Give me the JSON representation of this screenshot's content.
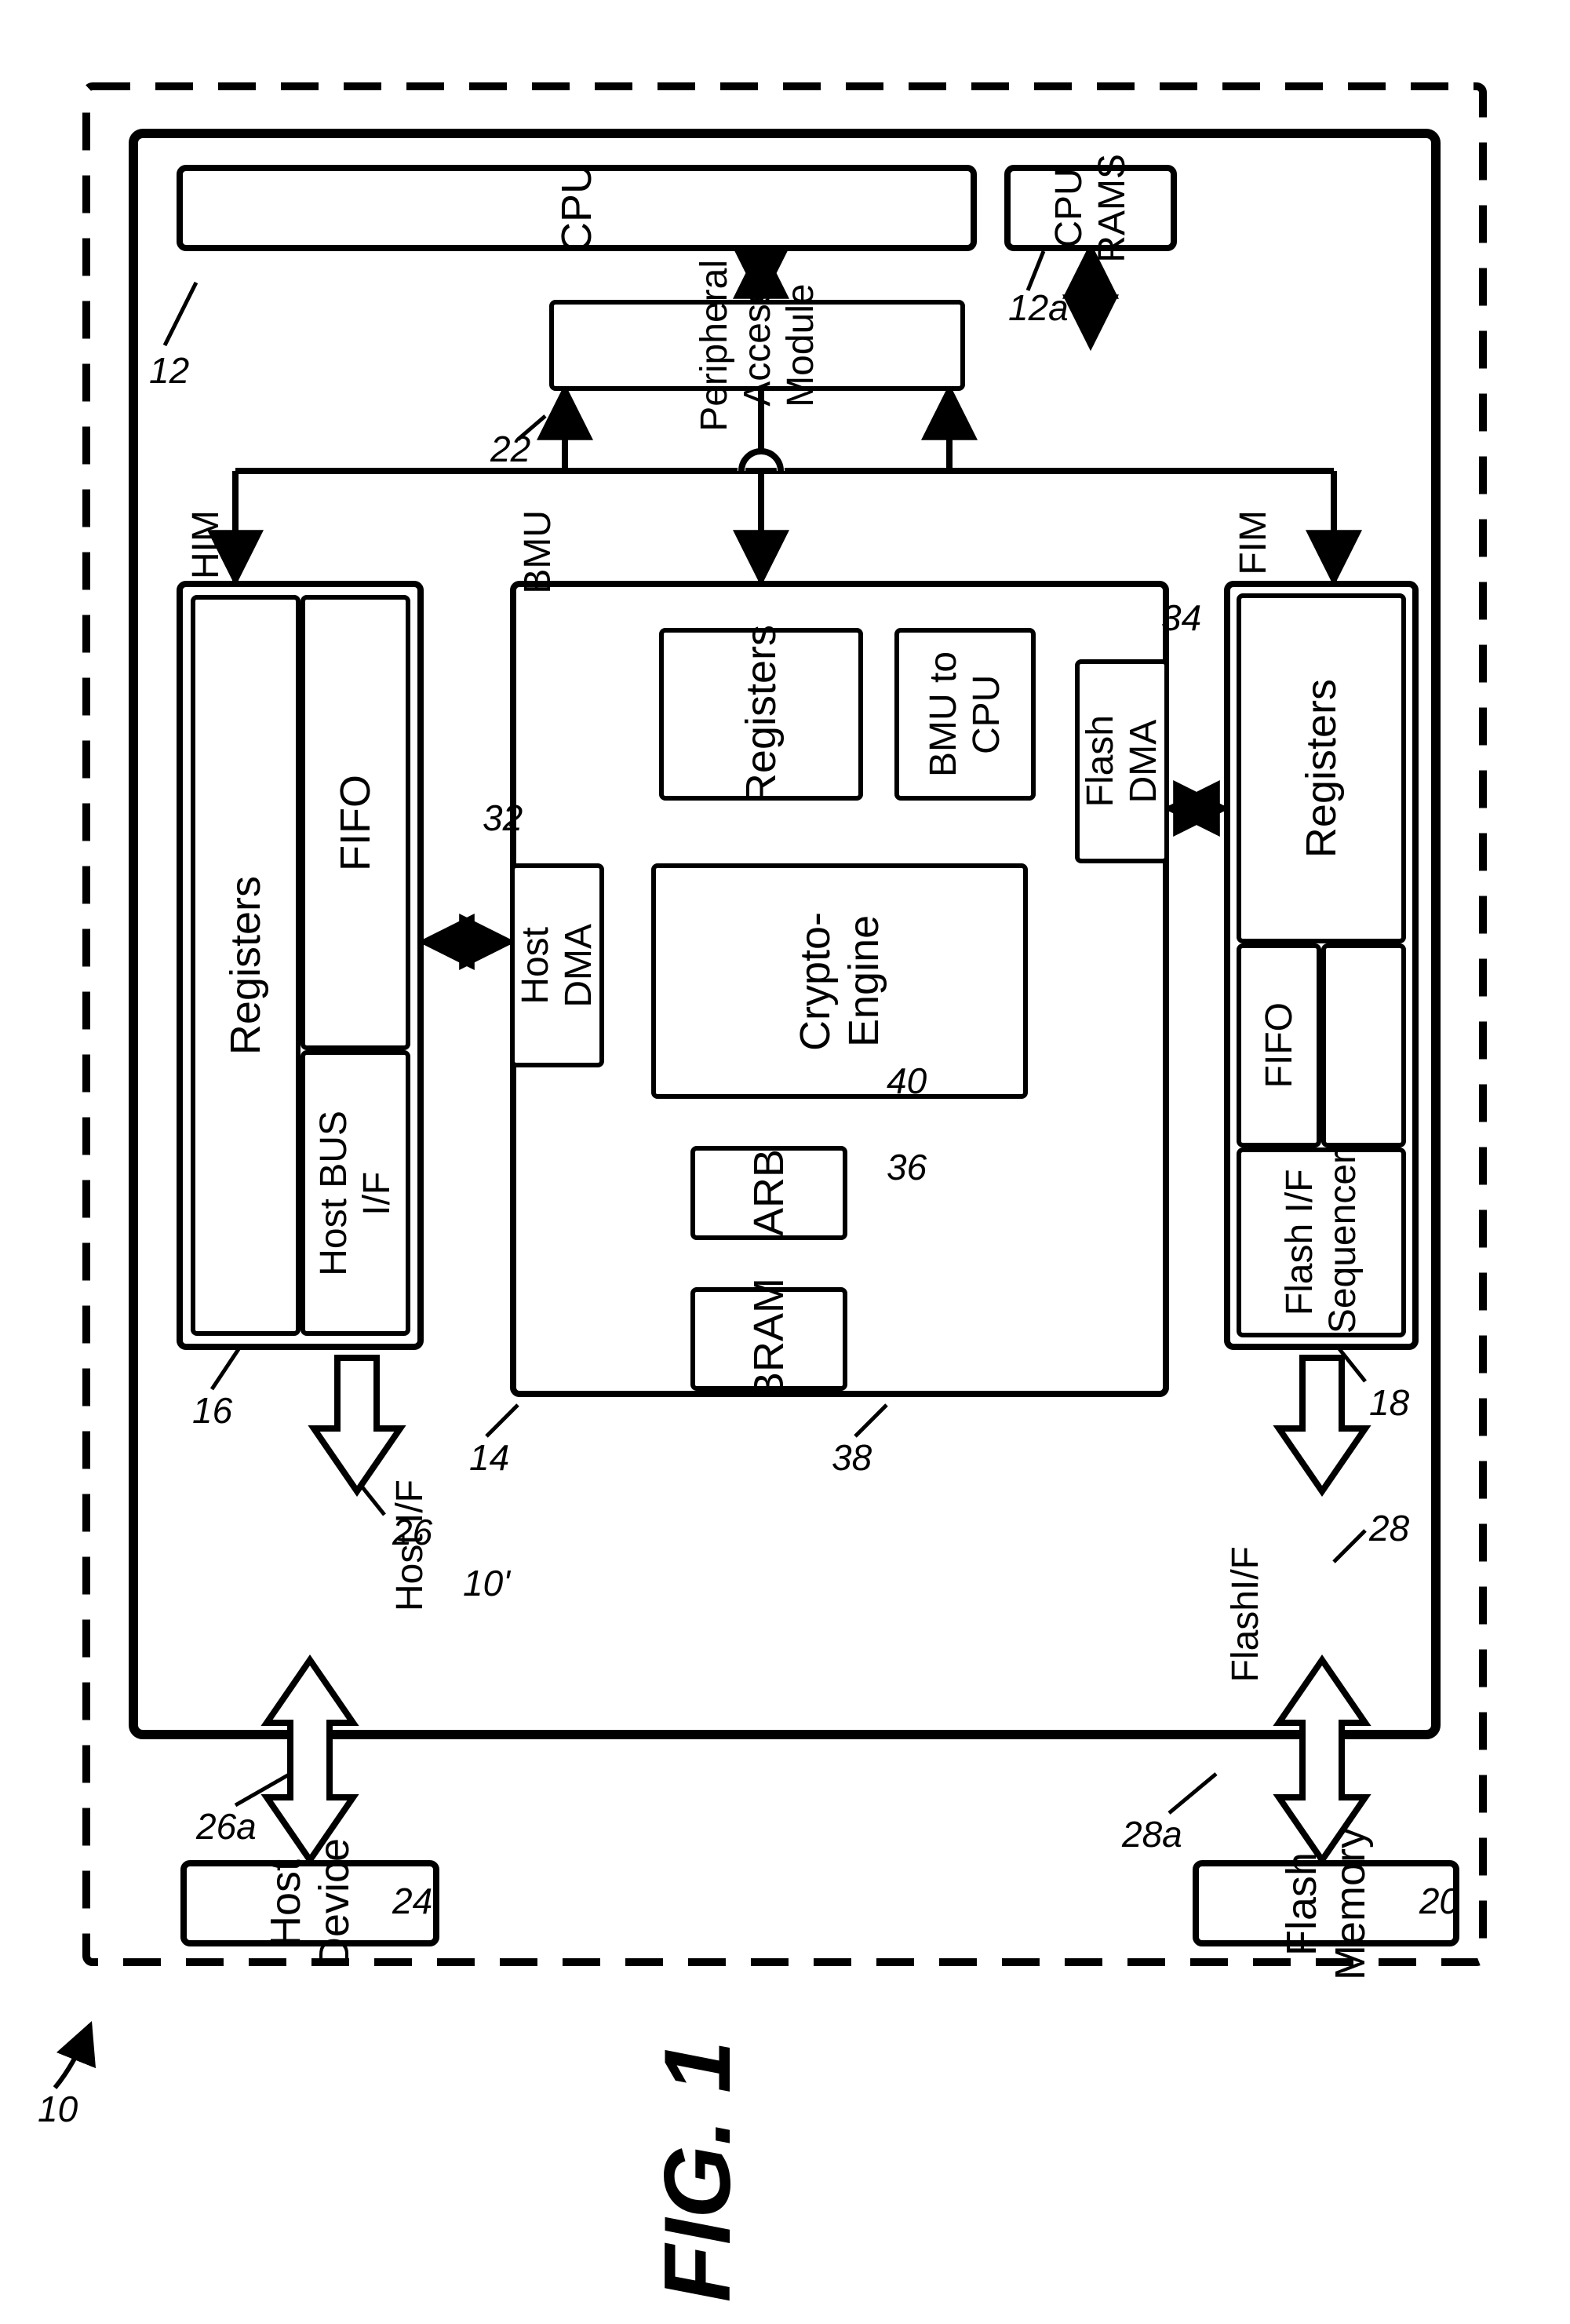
{
  "fig_title": "FIG. 1",
  "refs": {
    "r10": "10",
    "r10p": "10'",
    "r12": "12",
    "r12a": "12a",
    "r14": "14",
    "r16": "16",
    "r18": "18",
    "r20": "20",
    "r22": "22",
    "r24": "24",
    "r26": "26",
    "r26a": "26a",
    "r28": "28",
    "r28a": "28a",
    "r32": "32",
    "r34": "34",
    "r36": "36",
    "r38": "38",
    "r40": "40"
  },
  "blocks": {
    "cpu": "CPU",
    "cpu_rams": "CPU RAMS",
    "pam": "Peripheral Access Module",
    "him": "HIM",
    "fim": "FIM",
    "bmu": "BMU",
    "him_registers": "Registers",
    "him_fifo": "FIFO",
    "him_hostbusif": "Host BUS\nI/F",
    "fim_registers": "Registers",
    "fim_fifo": "FIFO",
    "fim_seq": "Flash I/F\nSequencer",
    "bmu_registers": "Registers",
    "bmu_to_cpu": "BMU to CPU",
    "host_dma": "Host\nDMA",
    "flash_dma": "Flash\nDMA",
    "crypto": "Crypto-Engine",
    "arb": "ARB",
    "bram": "BRAM",
    "host_if": "Host I/F",
    "flash_if": "FlashI/F",
    "host_device": "Host Device",
    "flash_memory": "Flash Memory"
  }
}
